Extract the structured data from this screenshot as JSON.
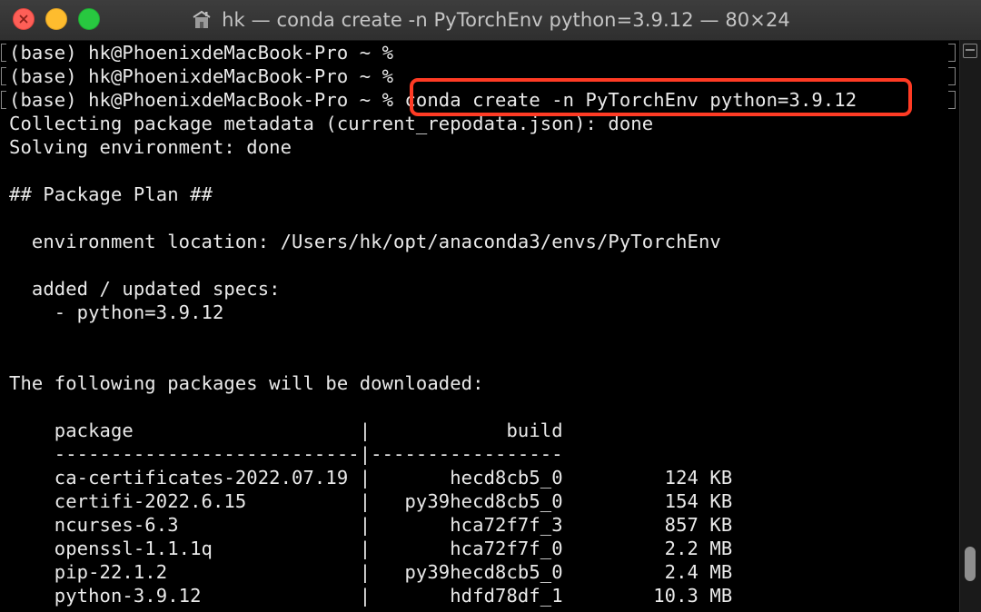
{
  "window": {
    "title": "hk — conda create -n PyTorchEnv python=3.9.12 — 80×24",
    "title_icon": "home-folder-icon"
  },
  "terminal": {
    "lines": [
      "(base) hk@PhoenixdeMacBook-Pro ~ %",
      "(base) hk@PhoenixdeMacBook-Pro ~ %",
      "(base) hk@PhoenixdeMacBook-Pro ~ % conda create -n PyTorchEnv python=3.9.12",
      "Collecting package metadata (current_repodata.json): done",
      "Solving environment: done",
      "",
      "## Package Plan ##",
      "",
      "  environment location: /Users/hk/opt/anaconda3/envs/PyTorchEnv",
      "",
      "  added / updated specs:",
      "    - python=3.9.12",
      "",
      "",
      "The following packages will be downloaded:",
      "",
      "    package                    |            build",
      "    ---------------------------|-----------------",
      "    ca-certificates-2022.07.19 |       hecd8cb5_0         124 KB",
      "    certifi-2022.6.15          |   py39hecd8cb5_0         154 KB",
      "    ncurses-6.3                |       hca72f7f_3         857 KB",
      "    openssl-1.1.1q             |       hca72f7f_0         2.2 MB",
      "    pip-22.1.2                 |   py39hecd8cb5_0         2.4 MB",
      "    python-3.9.12              |       hdfd78df_1        10.3 MB"
    ]
  },
  "colors": {
    "highlight": "#ff3b24",
    "text": "#eaeaea",
    "background": "#000000"
  }
}
